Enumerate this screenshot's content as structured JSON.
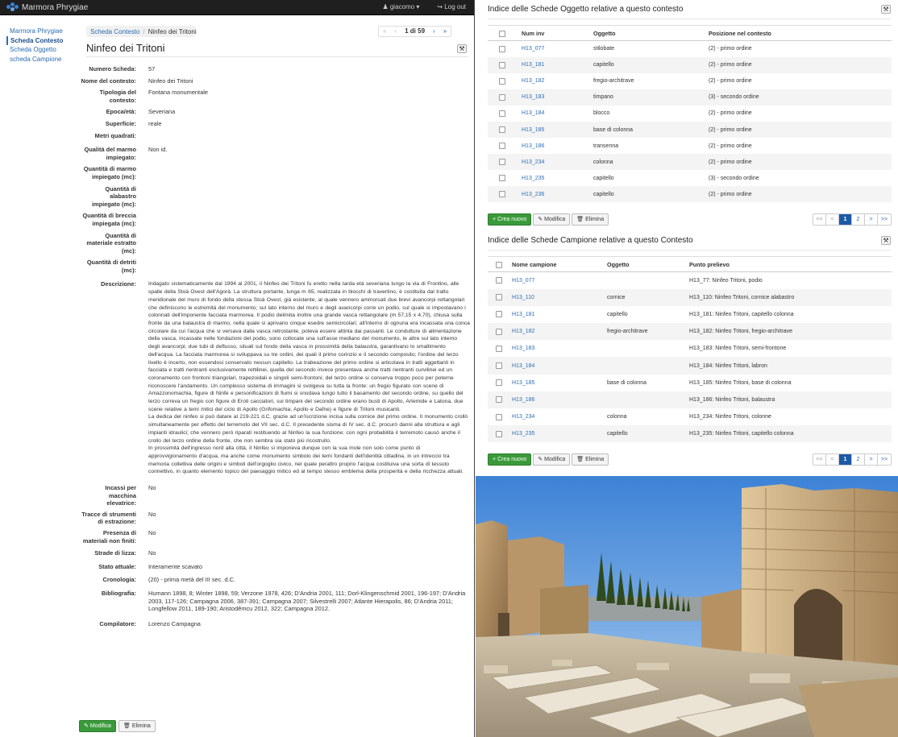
{
  "app": {
    "brand": "Marmora Phrygiae",
    "user": "giacomo",
    "logout": "Log out"
  },
  "sidebar": {
    "items": [
      {
        "label": "Marmora Phrygiae",
        "active": false
      },
      {
        "label": "Scheda Contesto",
        "active": true
      },
      {
        "label": "Scheda Oggetto",
        "active": false
      },
      {
        "label": "scheda Campione",
        "active": false
      }
    ]
  },
  "breadcrumb": {
    "link": "Scheda Contesto",
    "separator": "/",
    "current": "Ninfeo dei Tritoni"
  },
  "pager": {
    "first": "«",
    "prev": "‹",
    "position": "1 di 59",
    "next": "›",
    "last": "»"
  },
  "page_title": "Ninfeo dei Tritoni",
  "fields": [
    {
      "label": "Numero Scheda:",
      "value": "57"
    },
    {
      "label": "Nome del contesto:",
      "value": "Ninfeo dei Tritoni"
    },
    {
      "label": "Tipologia del contesto:",
      "value": "Fontana monumentale"
    },
    {
      "label": "Epoca/età:",
      "value": "Severiana"
    },
    {
      "label": "Superficie:",
      "value": "reale"
    },
    {
      "label": "Metri quadrati:",
      "value": ""
    },
    {
      "label": "Qualità del marmo impiegato:",
      "value": "Non id."
    },
    {
      "label": "Quantità di marmo impiegato (mc):",
      "value": ""
    },
    {
      "label": "Quantità di alabastro impiegato (mc):",
      "value": ""
    },
    {
      "label": "Quantità di breccia impiegata (mc):",
      "value": ""
    },
    {
      "label": "Quantità di materiale estratto (mc):",
      "value": ""
    },
    {
      "label": "Quantità di detriti (mc):",
      "value": ""
    }
  ],
  "description": {
    "label": "Descrizione:",
    "p1": "Indagato sistematicamente dal 1994 al 2001, il Ninfeo dei Tritoni fu eretto nella tarda età severiana lungo la via di Frontino, alle spalle della Stoà Ovest dell'Agorà. La struttura portante, lunga m 65, realizzata in blocchi di travertino, è costituita dal tratto meridionale del muro di fondo della stessa Stoà Ovest, già esistente, al quale vennero ammorsati due brevi avancorpi rettangolari che definiscono le estremità del monumento; sul lato interno del muro e degli avancorpi corre un podio, sul quale si impostavano i colonnati dell'imponente facciata marmorea. Il podio delimita inoltre una grande vasca rettangolare (m 57,15 x 4,70), chiusa sulla fronte da una balaustra di marmo, nella quale si aprivano cinque esedre semicircolari; all'interno di ognuna era incassata una conca circolare da cui l'acqua che si versava dalla vasca retrostante, poteva essere attinta dai passanti. Le condutture di alimentazione della vasca, incassate nelle fondazioni del podio, sono collocate una sull'asse mediano del monumento, le altre sul lato interno degli avancorpi; due tubi di deflusso, situati sul fondo della vasca in prossimità della balaustra, garantivano lo smaltimento dell'acqua. La facciata marmorea si sviluppava su tre ordini, dei quali il primo corinzio e il secondo composito; l'ordine del terzo livello è incerto, non essendosi conservato nessun capitello. La trabeazione del primo ordine si articolava in tratti aggettanti in facciata e tratti rientranti esclusivamente rettilinei, quella del secondo invece presentava anche tratti rientranti curvilinei ed un coronamento con frontoni triangolari, trapezoidali e singoli semi-frontoni; del terzo ordine si conserva troppo poco per poterne riconoscere l'andamento. Un complesso sistema di immagini si svolgeva su tutta la fronte: un fregio figurato con scene di Amazzonomachia, figure di Ninfe e personificazioni di fiumi si snodava lungo tutto il basamento del secondo ordine, su quello del terzo correva un fregio con figure di Eroti cacciatori, sui timpani del secondo ordine erano busti di Apollo, Artemide e Latona, due scene relative a temi mitici del ciclo di Apollo (Grifomachia; Apollo e Dafne) e figure di Tritoni musicanti.",
    "p2": "La dedica del ninfeo si può datare al 219-221 d.C. grazie ad un'iscrizione incisa sulla cornice del primo ordine. Il monumento crollò simultaneamente per effetto del terremoto del VII sec. d.C. Il precedente sisma di IV sec. d.C. procurò danni alla struttura e agli impianti idraulici; che vennero però riparati restituendo al Ninfeo la sua funzione; con ogni probabilità il terremoto causò anche il crollo del terzo ordine della fronte, che non sembra sia stato più ricostruito.",
    "p3": "In prossimità dell'ingresso nord alla città, il Ninfeo si imponeva dunque con la sua mole non solo come punto di approvvigionamento d'acqua, ma anche come monumento simbolo dei temi fondanti dell'identità cittadina, in un intreccio tra memoria collettiva delle origini e simboli dell'orgoglio civico, nel quale peraltro proprio l'acqua costituiva una sorta di tessuto connettivo, in quanto elemento topico del paesaggio mitico ed al tempo stesso emblema della prosperità e della ricchezza attuali."
  },
  "fields2": [
    {
      "label": "Incassi per macchina elevatrice:",
      "value": "No"
    },
    {
      "label": "Tracce di strumenti di estrazione:",
      "value": "No"
    },
    {
      "label": "Presenza di materiali non finiti:",
      "value": "No"
    },
    {
      "label": "Strade di lizza:",
      "value": "No"
    },
    {
      "label": "Stato attuale:",
      "value": "Interamente scavato"
    },
    {
      "label": "Cronologia:",
      "value": "(20) - prima metà del III sec. d.C."
    },
    {
      "label": "Bibliografia:",
      "value": "Humann 1898, 8; Winter 1898, 59; Verzone 1978, 426; D'Andria 2001, 111; Dorl-Klingenschmid 2001, 196-197; D'Andria 2003, 117-126; Campagna 2006, 387-391; Campagna 2007; Silvestrelli 2007; Atlante Hierapolis, 86; D'Andria 2011; Longfellow 2011, 189-190; Aristodêmcu 2012, 322; Campagna 2012."
    },
    {
      "label": "Compilatore:",
      "value": "Lorenzo Campagna"
    }
  ],
  "actions": {
    "edit": "Modifica",
    "delete": "Elimina"
  },
  "oggetti": {
    "title": "Indice delle Schede Oggetto relative a questo contesto",
    "headers": [
      "Num inv",
      "Oggetto",
      "Posizione nel contesto"
    ],
    "rows": [
      [
        "H13_077",
        "stilobate",
        "(2) - primo ordine"
      ],
      [
        "H13_181",
        "capitello",
        "(2) - primo ordine"
      ],
      [
        "H13_182",
        "fregio-architrave",
        "(2) - primo ordine"
      ],
      [
        "H13_183",
        "timpano",
        "(3) - secondo ordine"
      ],
      [
        "H13_184",
        "blocco",
        "(2) - primo ordine"
      ],
      [
        "H13_185",
        "base di colonna",
        "(2) - primo ordine"
      ],
      [
        "H13_186",
        "transenna",
        "(2) - primo ordine"
      ],
      [
        "H13_234",
        "colonna",
        "(2) - primo ordine"
      ],
      [
        "H13_235",
        "capitello",
        "(3) - secondo ordine"
      ],
      [
        "H13_236",
        "capitello",
        "(2) - primo ordine"
      ]
    ],
    "buttons": {
      "new": "Crea nuovo",
      "edit": "Modifica",
      "delete": "Elimina"
    },
    "pages": [
      "<<",
      "<",
      "1",
      "2",
      ">",
      ">>"
    ]
  },
  "campioni": {
    "title": "Indice delle Schede Campione relative a questo Contesto",
    "headers": [
      "Nome campione",
      "Oggetto",
      "Punto prelievo"
    ],
    "rows": [
      [
        "H13_077",
        "",
        "H13_77: Ninfeo Tritoni, podio"
      ],
      [
        "H13_110",
        "cornice",
        "H13_110: Ninfeo Tritoni, cornice alabastro"
      ],
      [
        "H13_181",
        "capitello",
        "H13_181: Ninfeo Tritoni, capitello colonna"
      ],
      [
        "H13_182",
        "fregio-architrave",
        "H13_182: Ninfeo Tritoni, fregio-architrave"
      ],
      [
        "H13_183",
        "",
        "H13_183: Ninfeo Tritoni, semi-frontone"
      ],
      [
        "H13_184",
        "",
        "H13_184: Ninfeo Tritoni, labron"
      ],
      [
        "H13_185",
        "base di colonna",
        "H13_185: Ninfeo Tritoni, base di colonna"
      ],
      [
        "H13_186",
        "",
        "H13_186: Ninfeo Tritoni, balaustra"
      ],
      [
        "H13_234",
        "colonna",
        "H13_234: Ninfeo Tritoni, colonne"
      ],
      [
        "H13_235",
        "capitello",
        "H13_235: Ninfeo Tritoni, capitello colonna"
      ]
    ],
    "buttons": {
      "new": "Crea nuovo",
      "edit": "Modifica",
      "delete": "Elimina"
    },
    "pages": [
      "<<",
      "<",
      "1",
      "2",
      ">",
      ">>"
    ]
  },
  "colors": {
    "link": "#2a6db3",
    "topbar": "#1f1f1f",
    "success": "#3a9a3a",
    "page_active": "#1d5aa6"
  }
}
